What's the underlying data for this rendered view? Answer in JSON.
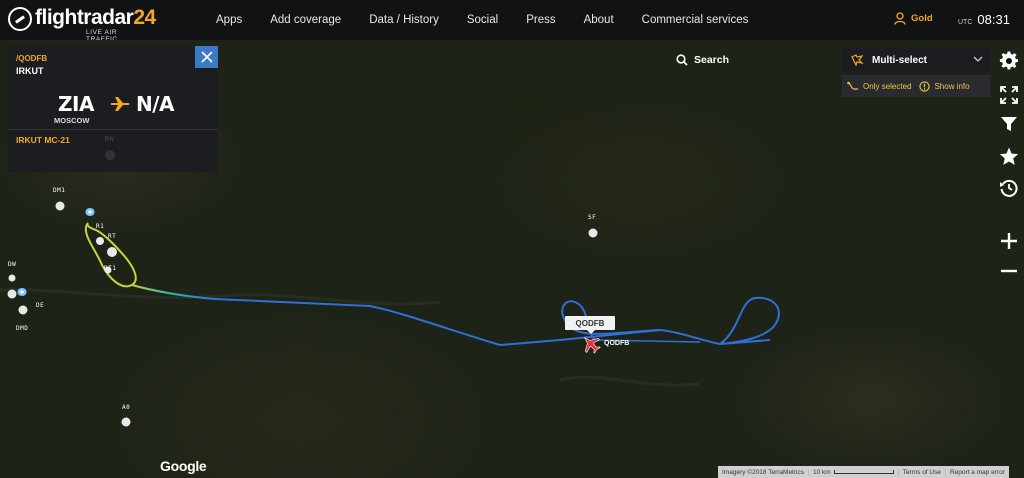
{
  "header": {
    "logo_text": "flightradar",
    "logo_number": "24",
    "logo_tagline": "LIVE AIR TRAFFIC",
    "nav": [
      "Apps",
      "Add coverage",
      "Data / History",
      "Social",
      "Press",
      "About",
      "Commercial services"
    ],
    "account_label": "Gold",
    "tz_label": "UTC",
    "time": "08:31"
  },
  "flight_panel": {
    "callsign": "/QODFB",
    "airline": "IRKUT",
    "origin_code": "ZIA",
    "origin_city": "MOSCOW",
    "destination_code": "N/A",
    "aircraft_type": "IRKUT MC-21",
    "registration_hint": "RN"
  },
  "search": {
    "label": "Search"
  },
  "multiselect": {
    "label": "Multi-select",
    "option_only_selected": "Only selected",
    "option_show_info": "Show info"
  },
  "map": {
    "aircraft_label": "QODFB",
    "aircraft_tag": "QODFB",
    "airports": [
      "DM1",
      "R1",
      "RT",
      "RT1",
      "DW",
      "DE",
      "DMD",
      "A0",
      "SF"
    ],
    "google_text": "Google",
    "attribution": [
      "Imagery ©2018 TerraMetrics",
      "10 km",
      "Terms of Use",
      "Report a map error"
    ]
  },
  "colors": {
    "accent": "#f5a623",
    "panel_bg": "#1c1d20",
    "close_button": "#3b7bc4",
    "track_high": "#2f6fd6",
    "track_mid": "#28b8a0",
    "track_low": "#c8d43a"
  },
  "toolbar_icons": [
    "gear-icon",
    "fullscreen-icon",
    "filter-icon",
    "star-icon",
    "playback-icon",
    "zoom-in-icon",
    "zoom-out-icon"
  ]
}
